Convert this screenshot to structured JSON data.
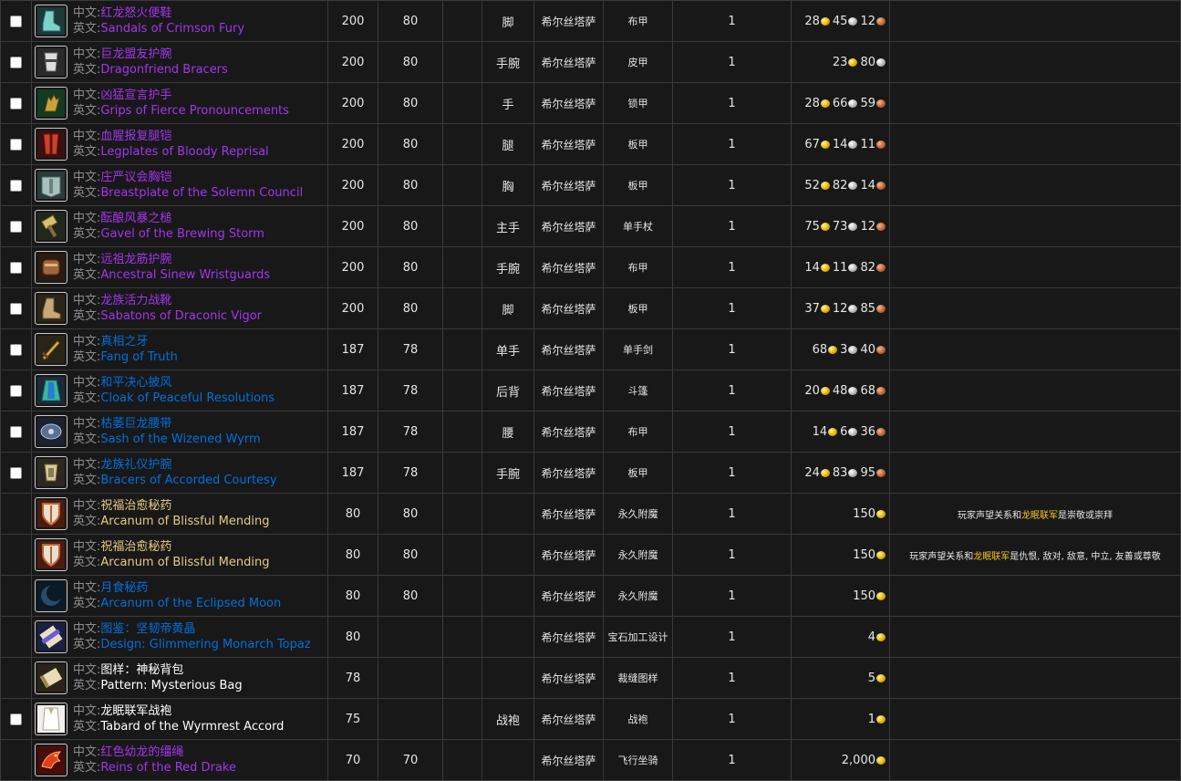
{
  "labels": {
    "zh": "中文:",
    "en": "英文:"
  },
  "colors": {
    "epic": "#a335ee",
    "rare": "#0070dd",
    "common": "#ffffff",
    "arcane": "#e6cc80",
    "highlight": "#f5c518"
  },
  "rows": [
    {
      "checkbox": true,
      "icon": "boots-icon",
      "zh": "红龙怒火便鞋",
      "en": "Sandals of Crimson Fury",
      "quality": "epic",
      "ilvl": "200",
      "req": "80",
      "slot": "脚",
      "zone": "希尔丝塔萨",
      "type": "布甲",
      "qty": "1",
      "gold": "28",
      "silver": "45",
      "copper": "12",
      "note": "",
      "note_hl": "",
      "note_tail": ""
    },
    {
      "checkbox": true,
      "icon": "bracers-icon",
      "zh": "巨龙盟友护腕",
      "en": "Dragonfriend Bracers",
      "quality": "epic",
      "ilvl": "200",
      "req": "80",
      "slot": "手腕",
      "zone": "希尔丝塔萨",
      "type": "皮甲",
      "qty": "1",
      "gold": "23",
      "silver": "80",
      "copper": "",
      "note": "",
      "note_hl": "",
      "note_tail": ""
    },
    {
      "checkbox": true,
      "icon": "gloves-icon",
      "zh": "凶猛宣言护手",
      "en": "Grips of Fierce Pronouncements",
      "quality": "epic",
      "ilvl": "200",
      "req": "80",
      "slot": "手",
      "zone": "希尔丝塔萨",
      "type": "锁甲",
      "qty": "1",
      "gold": "28",
      "silver": "66",
      "copper": "59",
      "note": "",
      "note_hl": "",
      "note_tail": ""
    },
    {
      "checkbox": true,
      "icon": "legplates-icon",
      "zh": "血腥报复腿铠",
      "en": "Legplates of Bloody Reprisal",
      "quality": "epic",
      "ilvl": "200",
      "req": "80",
      "slot": "腿",
      "zone": "希尔丝塔萨",
      "type": "板甲",
      "qty": "1",
      "gold": "67",
      "silver": "14",
      "copper": "11",
      "note": "",
      "note_hl": "",
      "note_tail": ""
    },
    {
      "checkbox": true,
      "icon": "breastplate-icon",
      "zh": "庄严议会胸铠",
      "en": "Breastplate of the Solemn Council",
      "quality": "epic",
      "ilvl": "200",
      "req": "80",
      "slot": "胸",
      "zone": "希尔丝塔萨",
      "type": "板甲",
      "qty": "1",
      "gold": "52",
      "silver": "82",
      "copper": "14",
      "note": "",
      "note_hl": "",
      "note_tail": ""
    },
    {
      "checkbox": true,
      "icon": "gavel-icon",
      "zh": "酝酿风暴之槌",
      "en": "Gavel of the Brewing Storm",
      "quality": "epic",
      "ilvl": "200",
      "req": "80",
      "slot": "主手",
      "zone": "希尔丝塔萨",
      "type": "单手杖",
      "qty": "1",
      "gold": "75",
      "silver": "73",
      "copper": "12",
      "note": "",
      "note_hl": "",
      "note_tail": ""
    },
    {
      "checkbox": true,
      "icon": "wristguards-icon",
      "zh": "远祖龙筋护腕",
      "en": "Ancestral Sinew Wristguards",
      "quality": "epic",
      "ilvl": "200",
      "req": "80",
      "slot": "手腕",
      "zone": "希尔丝塔萨",
      "type": "布甲",
      "qty": "1",
      "gold": "14",
      "silver": "11",
      "copper": "82",
      "note": "",
      "note_hl": "",
      "note_tail": ""
    },
    {
      "checkbox": true,
      "icon": "sabatons-icon",
      "zh": "龙族活力战靴",
      "en": "Sabatons of Draconic Vigor",
      "quality": "epic",
      "ilvl": "200",
      "req": "80",
      "slot": "脚",
      "zone": "希尔丝塔萨",
      "type": "板甲",
      "qty": "1",
      "gold": "37",
      "silver": "12",
      "copper": "85",
      "note": "",
      "note_hl": "",
      "note_tail": ""
    },
    {
      "checkbox": true,
      "icon": "sword-icon",
      "zh": "真相之牙",
      "en": "Fang of Truth",
      "quality": "rare",
      "ilvl": "187",
      "req": "78",
      "slot": "单手",
      "zone": "希尔丝塔萨",
      "type": "单手剑",
      "qty": "1",
      "gold": "68",
      "silver": "3",
      "copper": "40",
      "note": "",
      "note_hl": "",
      "note_tail": ""
    },
    {
      "checkbox": true,
      "icon": "cloak-icon",
      "zh": "和平决心披风",
      "en": "Cloak of Peaceful Resolutions",
      "quality": "rare",
      "ilvl": "187",
      "req": "78",
      "slot": "后背",
      "zone": "希尔丝塔萨",
      "type": "斗篷",
      "qty": "1",
      "gold": "20",
      "silver": "48",
      "copper": "68",
      "note": "",
      "note_hl": "",
      "note_tail": ""
    },
    {
      "checkbox": true,
      "icon": "sash-icon",
      "zh": "枯萎巨龙腰带",
      "en": "Sash of the Wizened Wyrm",
      "quality": "rare",
      "ilvl": "187",
      "req": "78",
      "slot": "腰",
      "zone": "希尔丝塔萨",
      "type": "布甲",
      "qty": "1",
      "gold": "14",
      "silver": "6",
      "copper": "36",
      "note": "",
      "note_hl": "",
      "note_tail": ""
    },
    {
      "checkbox": true,
      "icon": "bracers-plate-icon",
      "zh": "龙族礼仪护腕",
      "en": "Bracers of Accorded Courtesy",
      "quality": "rare",
      "ilvl": "187",
      "req": "78",
      "slot": "手腕",
      "zone": "希尔丝塔萨",
      "type": "板甲",
      "qty": "1",
      "gold": "24",
      "silver": "83",
      "copper": "95",
      "note": "",
      "note_hl": "",
      "note_tail": ""
    },
    {
      "checkbox": false,
      "icon": "shield-icon",
      "zh": "祝福治愈秘药",
      "en": "Arcanum of Blissful Mending",
      "quality": "arcane",
      "ilvl": "80",
      "req": "80",
      "slot": "",
      "zone": "希尔丝塔萨",
      "type": "永久附魔",
      "qty": "1",
      "gold": "150",
      "silver": "",
      "copper": "",
      "note": "玩家声望关系和",
      "note_hl": "龙眠联军",
      "note_tail": "是崇敬或崇拜"
    },
    {
      "checkbox": false,
      "icon": "shield-icon",
      "zh": "祝福治愈秘药",
      "en": "Arcanum of Blissful Mending",
      "quality": "arcane",
      "ilvl": "80",
      "req": "80",
      "slot": "",
      "zone": "希尔丝塔萨",
      "type": "永久附魔",
      "qty": "1",
      "gold": "150",
      "silver": "",
      "copper": "",
      "note": "玩家声望关系和",
      "note_hl": "龙眠联军",
      "note_tail": "是仇恨, 敌对, 敌意, 中立, 友善或尊敬"
    },
    {
      "checkbox": false,
      "icon": "moon-icon",
      "zh": "月食秘药",
      "en": "Arcanum of the Eclipsed Moon",
      "quality": "rare",
      "ilvl": "80",
      "req": "80",
      "slot": "",
      "zone": "希尔丝塔萨",
      "type": "永久附魔",
      "qty": "1",
      "gold": "150",
      "silver": "",
      "copper": "",
      "note": "",
      "note_hl": "",
      "note_tail": ""
    },
    {
      "checkbox": false,
      "icon": "scroll-blue-icon",
      "zh": "图鉴：坚韧帝黄晶",
      "en": "Design: Glimmering Monarch Topaz",
      "quality": "rare",
      "ilvl": "80",
      "req": "",
      "slot": "",
      "zone": "希尔丝塔萨",
      "type": "宝石加工设计",
      "qty": "1",
      "gold": "4",
      "silver": "",
      "copper": "",
      "note": "",
      "note_hl": "",
      "note_tail": ""
    },
    {
      "checkbox": false,
      "icon": "scroll-icon",
      "zh": "图样：神秘背包",
      "en": "Pattern: Mysterious Bag",
      "quality": "common",
      "ilvl": "78",
      "req": "",
      "slot": "",
      "zone": "希尔丝塔萨",
      "type": "裁缝图样",
      "qty": "1",
      "gold": "5",
      "silver": "",
      "copper": "",
      "note": "",
      "note_hl": "",
      "note_tail": ""
    },
    {
      "checkbox": true,
      "icon": "tabard-icon",
      "zh": "龙眠联军战袍",
      "en": "Tabard of the Wyrmrest Accord",
      "quality": "common",
      "ilvl": "75",
      "req": "",
      "slot": "战袍",
      "zone": "希尔丝塔萨",
      "type": "战袍",
      "qty": "1",
      "gold": "1",
      "silver": "",
      "copper": "",
      "note": "",
      "note_hl": "",
      "note_tail": ""
    },
    {
      "checkbox": false,
      "icon": "drake-icon",
      "zh": "红色幼龙的缰绳",
      "en": "Reins of the Red Drake",
      "quality": "epic",
      "ilvl": "70",
      "req": "70",
      "slot": "",
      "zone": "希尔丝塔萨",
      "type": "飞行坐骑",
      "qty": "1",
      "gold": "2,000",
      "silver": "",
      "copper": "",
      "note": "",
      "note_hl": "",
      "note_tail": ""
    }
  ]
}
